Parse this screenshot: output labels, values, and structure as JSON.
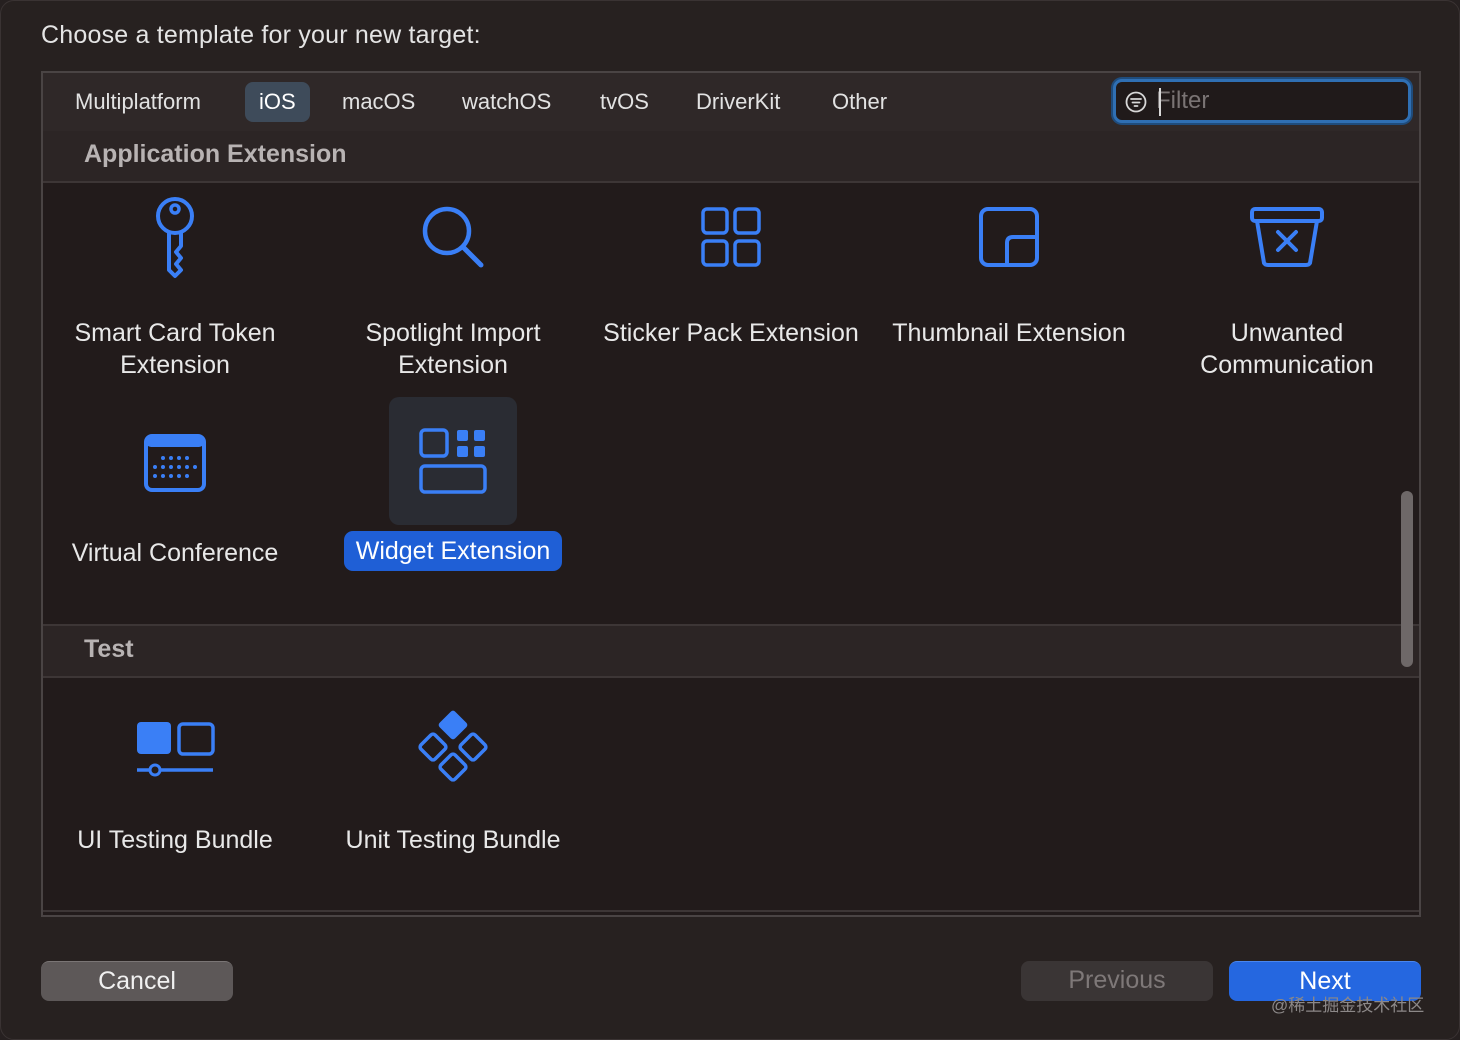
{
  "header": {
    "title": "Choose a template for your new target:"
  },
  "tabs": [
    {
      "label": "Multiplatform"
    },
    {
      "label": "iOS"
    },
    {
      "label": "macOS"
    },
    {
      "label": "watchOS"
    },
    {
      "label": "tvOS"
    },
    {
      "label": "DriverKit"
    },
    {
      "label": "Other"
    }
  ],
  "selected_tab": "iOS",
  "filter": {
    "placeholder": "Filter",
    "value": "",
    "icon": "filter-circle-icon"
  },
  "sections": [
    {
      "title": "Application Extension",
      "items": [
        {
          "label": "Smart Card Token Extension",
          "icon": "key-icon"
        },
        {
          "label": "Spotlight Import Extension",
          "icon": "magnifier-icon"
        },
        {
          "label": "Sticker Pack Extension",
          "icon": "grid-icon"
        },
        {
          "label": "Thumbnail Extension",
          "icon": "thumbnail-icon"
        },
        {
          "label": "Unwanted Communication",
          "icon": "trash-x-icon"
        },
        {
          "label": "Virtual Conference",
          "icon": "calendar-icon"
        },
        {
          "label": "Widget Extension",
          "icon": "widget-icon",
          "selected": true
        }
      ]
    },
    {
      "title": "Test",
      "items": [
        {
          "label": "UI Testing Bundle",
          "icon": "ui-testing-icon"
        },
        {
          "label": "Unit Testing Bundle",
          "icon": "unit-testing-icon"
        }
      ]
    }
  ],
  "buttons": {
    "cancel": "Cancel",
    "previous": "Previous",
    "next": "Next"
  },
  "watermark": "@稀土掘金技术社区",
  "colors": {
    "accent": "#2567e0",
    "icon_blue": "#3a7ff6",
    "selected_tab_bg": "#3e4b5a"
  }
}
